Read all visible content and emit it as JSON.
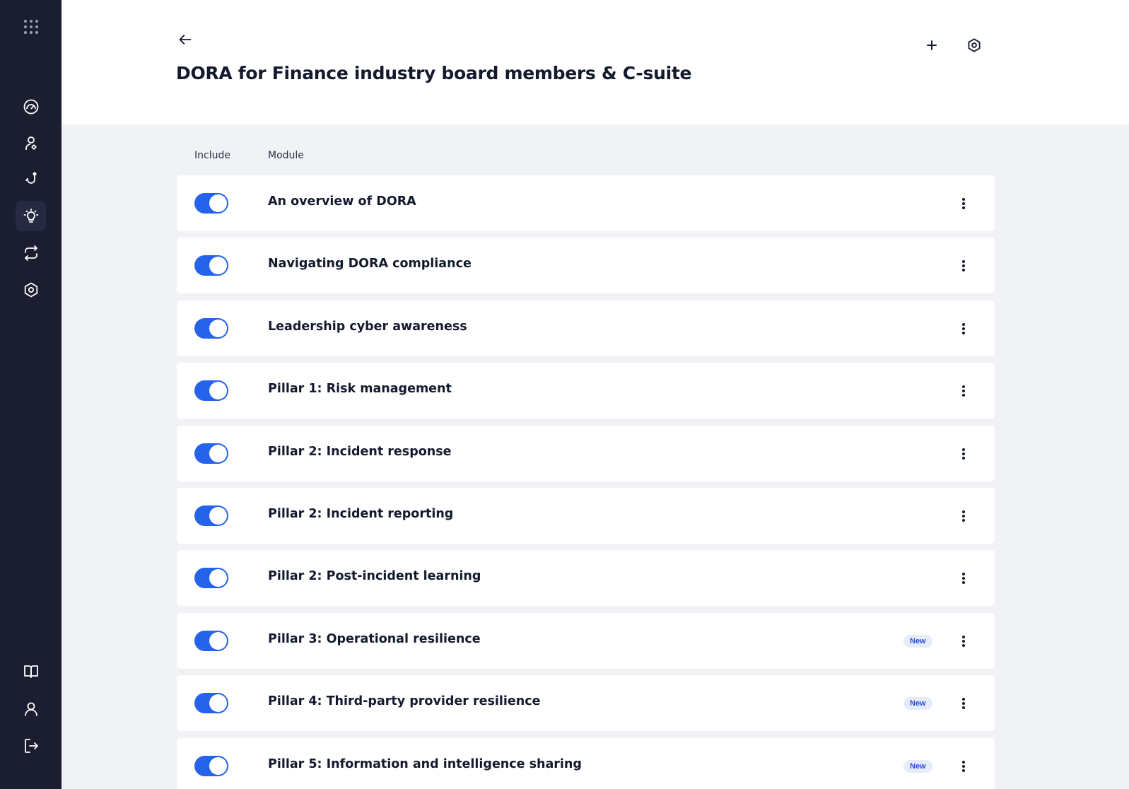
{
  "header": {
    "title": "DORA for Finance industry board members & C-suite"
  },
  "columns": {
    "include": "Include",
    "module": "Module"
  },
  "modules": [
    {
      "title": "An overview of DORA",
      "included": true,
      "badge": ""
    },
    {
      "title": "Navigating DORA compliance",
      "included": true,
      "badge": ""
    },
    {
      "title": "Leadership cyber awareness",
      "included": true,
      "badge": ""
    },
    {
      "title": "Pillar 1: Risk management",
      "included": true,
      "badge": ""
    },
    {
      "title": "Pillar 2: Incident response",
      "included": true,
      "badge": ""
    },
    {
      "title": "Pillar 2: Incident reporting",
      "included": true,
      "badge": ""
    },
    {
      "title": "Pillar 2: Post-incident learning",
      "included": true,
      "badge": ""
    },
    {
      "title": "Pillar 3: Operational resilience",
      "included": true,
      "badge": "New"
    },
    {
      "title": "Pillar 4: Third-party provider resilience",
      "included": true,
      "badge": "New"
    },
    {
      "title": "Pillar 5: Information and intelligence sharing",
      "included": true,
      "badge": "New"
    }
  ],
  "icons": {
    "sidebar_top": "grid-dots-icon",
    "sidebar_nav": [
      "dashboard-icon",
      "users-settings-icon",
      "hook-icon",
      "lightbulb-icon",
      "repeat-icon",
      "hexagon-settings-icon"
    ],
    "sidebar_bottom": [
      "book-icon",
      "user-icon",
      "logout-icon"
    ],
    "header": [
      "back-arrow-icon",
      "plus-icon",
      "hexagon-settings-icon"
    ],
    "row_menu": "kebab-icon"
  },
  "colors": {
    "sidebar": "#1b1d30",
    "accent": "#2563eb",
    "badge_bg": "#e7ecfb",
    "badge_text": "#2a4bd8",
    "page_bg": "#f1f2f6"
  }
}
